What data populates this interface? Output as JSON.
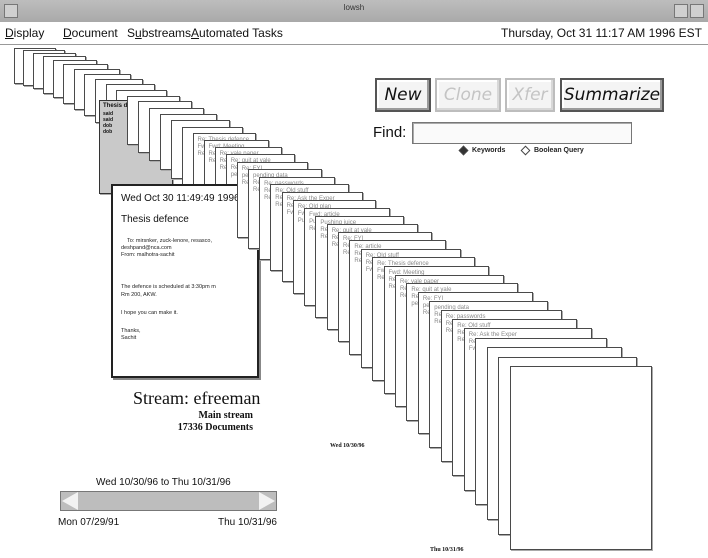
{
  "window": {
    "title": "lowsh"
  },
  "menu": {
    "items": [
      {
        "pre": "",
        "key": "D",
        "post": "isplay"
      },
      {
        "pre": "",
        "key": "D",
        "post": "ocument"
      },
      {
        "pre": "S",
        "key": "u",
        "post": "bstreams"
      },
      {
        "pre": "",
        "key": "A",
        "post": "utomated Tasks"
      }
    ],
    "datetime": "Thursday, Oct 31 11:17 AM 1996 EST"
  },
  "toolbar": {
    "new_label": "New",
    "clone_label": "Clone",
    "xfer_label": "Xfer",
    "summarize_label": "Summarize"
  },
  "find": {
    "label": "Find:",
    "value": "",
    "options": [
      {
        "label": "Keywords",
        "selected": true
      },
      {
        "label": "Boolean Query",
        "selected": false
      }
    ]
  },
  "selected_document": {
    "date": "Wed Oct 30 11:49:49 1996",
    "subject": "Thesis defence",
    "to_line": "To: mirsnker, zuck-lenore, resasco,",
    "to_line2": "deshpand@nca.com",
    "from_line": "From: malhotra-sachit",
    "body1": "The defence is scheduled at 3:30pm m",
    "body2": "Rm 200, AKW.",
    "body3": "I hope you can make it.",
    "sign1": "Thanks,",
    "sign2": "Sachit"
  },
  "highlighted_card": {
    "title": "Thesis defence",
    "lines": [
      "said",
      "said",
      "dob",
      "dob"
    ]
  },
  "stream": {
    "title": "Stream: efreeman",
    "subtitle": "Main stream",
    "count": "17336 Documents"
  },
  "date_markers": {
    "mid": "Wed 10/30/96",
    "end": "Thu 10/31/96"
  },
  "time_slider": {
    "range_label": "Wed 10/30/96 to Thu 10/31/96",
    "start_label": "Mon 07/29/91",
    "end_label": "Thu 10/31/96"
  },
  "card_snippets": [
    "Re: Old stuff",
    "Re: Thesis defence",
    "Fwd: Meeting",
    "Re: yale paper",
    "Re: quit at yale",
    "Re: FYI",
    "pending data",
    "Re: passwords",
    "Re: Old stuff",
    "Re: Ask the Exper",
    "Re: Old plan",
    "Fwd: article",
    "Pushing juice",
    "Re: quit at yale",
    "Re: FYI",
    "Re: article"
  ]
}
